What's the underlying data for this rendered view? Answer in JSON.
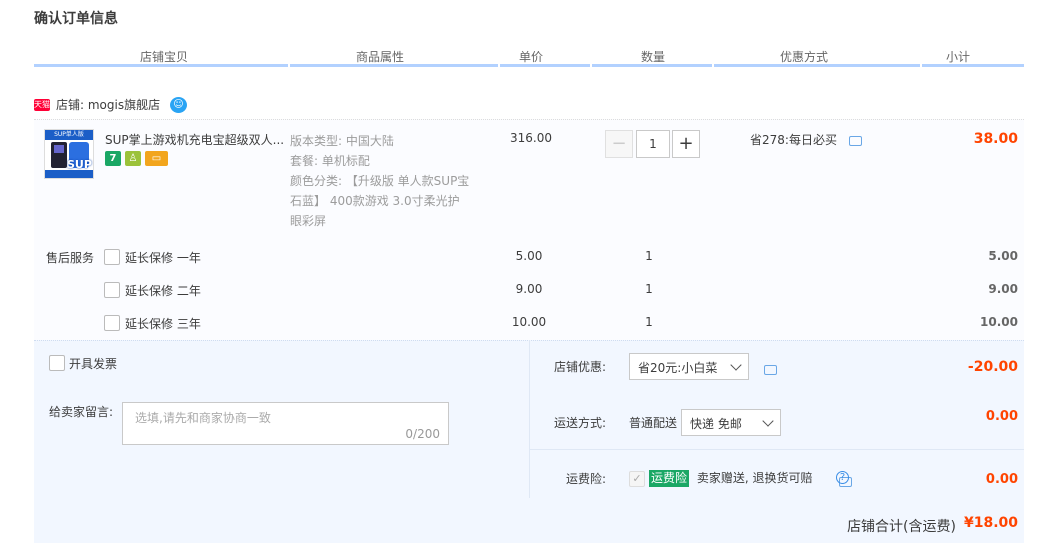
{
  "page_title": "确认订单信息",
  "columns": [
    "店铺宝贝",
    "商品属性",
    "单价",
    "数量",
    "优惠方式",
    "小计"
  ],
  "shop": {
    "badge": "天猫",
    "label": "店铺: mogis旗舰店"
  },
  "item": {
    "thumb_text": "SUP单人版",
    "thumb_logo": "SUP",
    "title": "SUP掌上游戏机充电宝超级双人...",
    "props": [
      "版本类型: 中国大陆",
      "套餐: 单机标配",
      "颜色分类: 【升级版 单人款SUP宝石蓝】 400款游戏 3.0寸柔光护眼彩屏"
    ],
    "price": "316.00",
    "quantity": "1",
    "promo": "省278:每日必买",
    "subtotal": "38.00",
    "service_icons": [
      "seven-day-return-icon",
      "android-icon",
      "card-icon"
    ]
  },
  "after_sales": {
    "title": "售后服务",
    "options": [
      {
        "label": "延长保修 一年",
        "price": "5.00",
        "qty": "1",
        "subtotal": "5.00"
      },
      {
        "label": "延长保修 二年",
        "price": "9.00",
        "qty": "1",
        "subtotal": "9.00"
      },
      {
        "label": "延长保修 三年",
        "price": "10.00",
        "qty": "1",
        "subtotal": "10.00"
      }
    ]
  },
  "invoice": {
    "label": "开具发票"
  },
  "message": {
    "label": "给卖家留言:",
    "placeholder": "选填,请先和商家协商一致",
    "counter": "0/200"
  },
  "shop_discount": {
    "label": "店铺优惠:",
    "selected": "省20元:小白菜",
    "amount": "-20.00"
  },
  "shipping": {
    "label": "运送方式:",
    "type": "普通配送",
    "selected": "快递 免邮",
    "amount": "0.00"
  },
  "insurance": {
    "label": "运费险:",
    "tag": "运费险",
    "text": "卖家赠送, 退换货可赔",
    "amount": "0.00"
  },
  "total": {
    "label": "店铺合计(含运费)",
    "value": "¥18.00"
  },
  "colors": {
    "accent_red": "#ff4400",
    "header_line": "#b2d1ff",
    "panel_bg": "#f2f7ff",
    "tag_green": "#1aa765"
  }
}
